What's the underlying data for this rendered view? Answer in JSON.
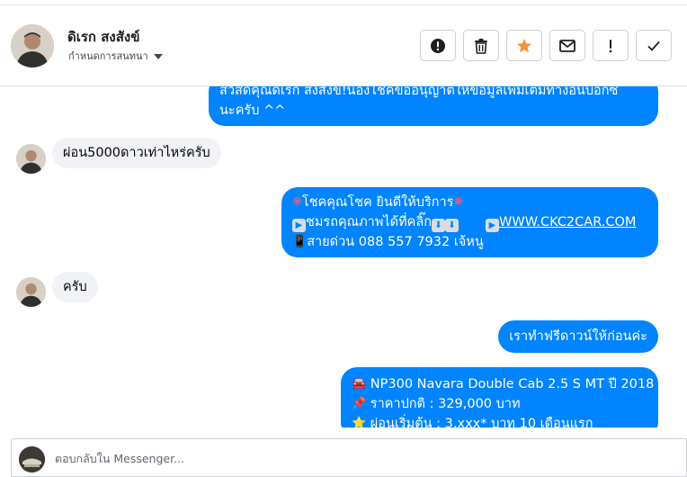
{
  "header": {
    "contact_name": "ดิเรก สงสังข์",
    "assign_label": "กำหนดการสนทนา",
    "actions": [
      {
        "icon": "exclamation-circle-icon"
      },
      {
        "icon": "trash-icon"
      },
      {
        "icon": "star-icon",
        "color": "#f7923b"
      },
      {
        "icon": "envelope-icon"
      },
      {
        "icon": "exclamation-icon"
      },
      {
        "icon": "check-icon"
      }
    ]
  },
  "messages": {
    "m1": {
      "line1": "สวัสดีคุณดิเรก สงสังข์!น้องโชคขออนุญาตให้ข้อมูลเพิ่มเติมทางอินบ็อกซ์",
      "line2": "นะครับ ^^"
    },
    "m2": {
      "text": "ผ่อน5000ดาวเท่าไหร่ครับ"
    },
    "m3": {
      "line1": "โชคคุณโชค ยินดีให้บริการ",
      "line2": "ชมรถคุณภาพได้ที่คลิ๊ก",
      "link": "WWW.CKC2CAR.COM",
      "line3": "สายด่วน 088 557 7932 เจ้หนู"
    },
    "m4": {
      "text": "ครับ"
    },
    "m5": {
      "text": "เราทำฟรีดาวน์ให้ก่อนค่ะ"
    },
    "m6": {
      "line1": "NP300 Navara Double Cab 2.5 S MT ปี 2018",
      "line2": "ราคาปกติ : 329,000 บาท",
      "line3": "ผ่อนเริ่มต้น : 3,xxx* บาท 10 เดือนแรก"
    }
  },
  "composer": {
    "placeholder": "ตอบกลับใน Messenger..."
  },
  "colors": {
    "outgoing_bubble": "#0084ff",
    "incoming_bubble": "#f0f2f5",
    "star": "#f7923b"
  }
}
